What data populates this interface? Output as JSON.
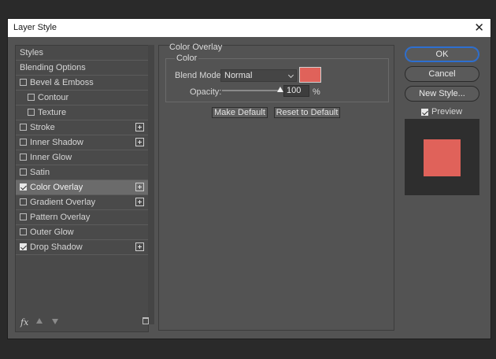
{
  "window": {
    "title": "Layer Style",
    "close_glyph": "✕"
  },
  "sidebar": {
    "items": [
      {
        "label": "Styles",
        "checkbox": false,
        "checked": false,
        "plus": false,
        "selected": false,
        "indent": 0
      },
      {
        "label": "Blending Options",
        "checkbox": false,
        "checked": false,
        "plus": false,
        "selected": false,
        "indent": 0
      },
      {
        "label": "Bevel & Emboss",
        "checkbox": true,
        "checked": false,
        "plus": false,
        "selected": false,
        "indent": 0
      },
      {
        "label": "Contour",
        "checkbox": true,
        "checked": false,
        "plus": false,
        "selected": false,
        "indent": 1
      },
      {
        "label": "Texture",
        "checkbox": true,
        "checked": false,
        "plus": false,
        "selected": false,
        "indent": 1
      },
      {
        "label": "Stroke",
        "checkbox": true,
        "checked": false,
        "plus": true,
        "selected": false,
        "indent": 0
      },
      {
        "label": "Inner Shadow",
        "checkbox": true,
        "checked": false,
        "plus": true,
        "selected": false,
        "indent": 0
      },
      {
        "label": "Inner Glow",
        "checkbox": true,
        "checked": false,
        "plus": false,
        "selected": false,
        "indent": 0
      },
      {
        "label": "Satin",
        "checkbox": true,
        "checked": false,
        "plus": false,
        "selected": false,
        "indent": 0
      },
      {
        "label": "Color Overlay",
        "checkbox": true,
        "checked": true,
        "plus": true,
        "selected": true,
        "indent": 0
      },
      {
        "label": "Gradient Overlay",
        "checkbox": true,
        "checked": false,
        "plus": true,
        "selected": false,
        "indent": 0
      },
      {
        "label": "Pattern Overlay",
        "checkbox": true,
        "checked": false,
        "plus": false,
        "selected": false,
        "indent": 0
      },
      {
        "label": "Outer Glow",
        "checkbox": true,
        "checked": false,
        "plus": false,
        "selected": false,
        "indent": 0
      },
      {
        "label": "Drop Shadow",
        "checkbox": true,
        "checked": true,
        "plus": true,
        "selected": false,
        "indent": 0
      }
    ],
    "footer": {
      "fx_label": "fx"
    }
  },
  "color_overlay": {
    "section_title": "Color Overlay",
    "group_title": "Color",
    "blend_mode_label": "Blend Mode:",
    "blend_mode_value": "Normal",
    "overlay_color": "#e0625a",
    "opacity_label": "Opacity:",
    "opacity_value": "100",
    "opacity_unit": "%",
    "opacity_fraction": 1.0,
    "make_default_label": "Make Default",
    "reset_default_label": "Reset to Default"
  },
  "actions": {
    "ok_label": "OK",
    "cancel_label": "Cancel",
    "new_style_label": "New Style...",
    "preview_label": "Preview",
    "preview_checked": true
  },
  "colors": {
    "dialog_bg": "#535353",
    "accent_border": "#2d6fd1",
    "overlay": "#e0625a"
  }
}
